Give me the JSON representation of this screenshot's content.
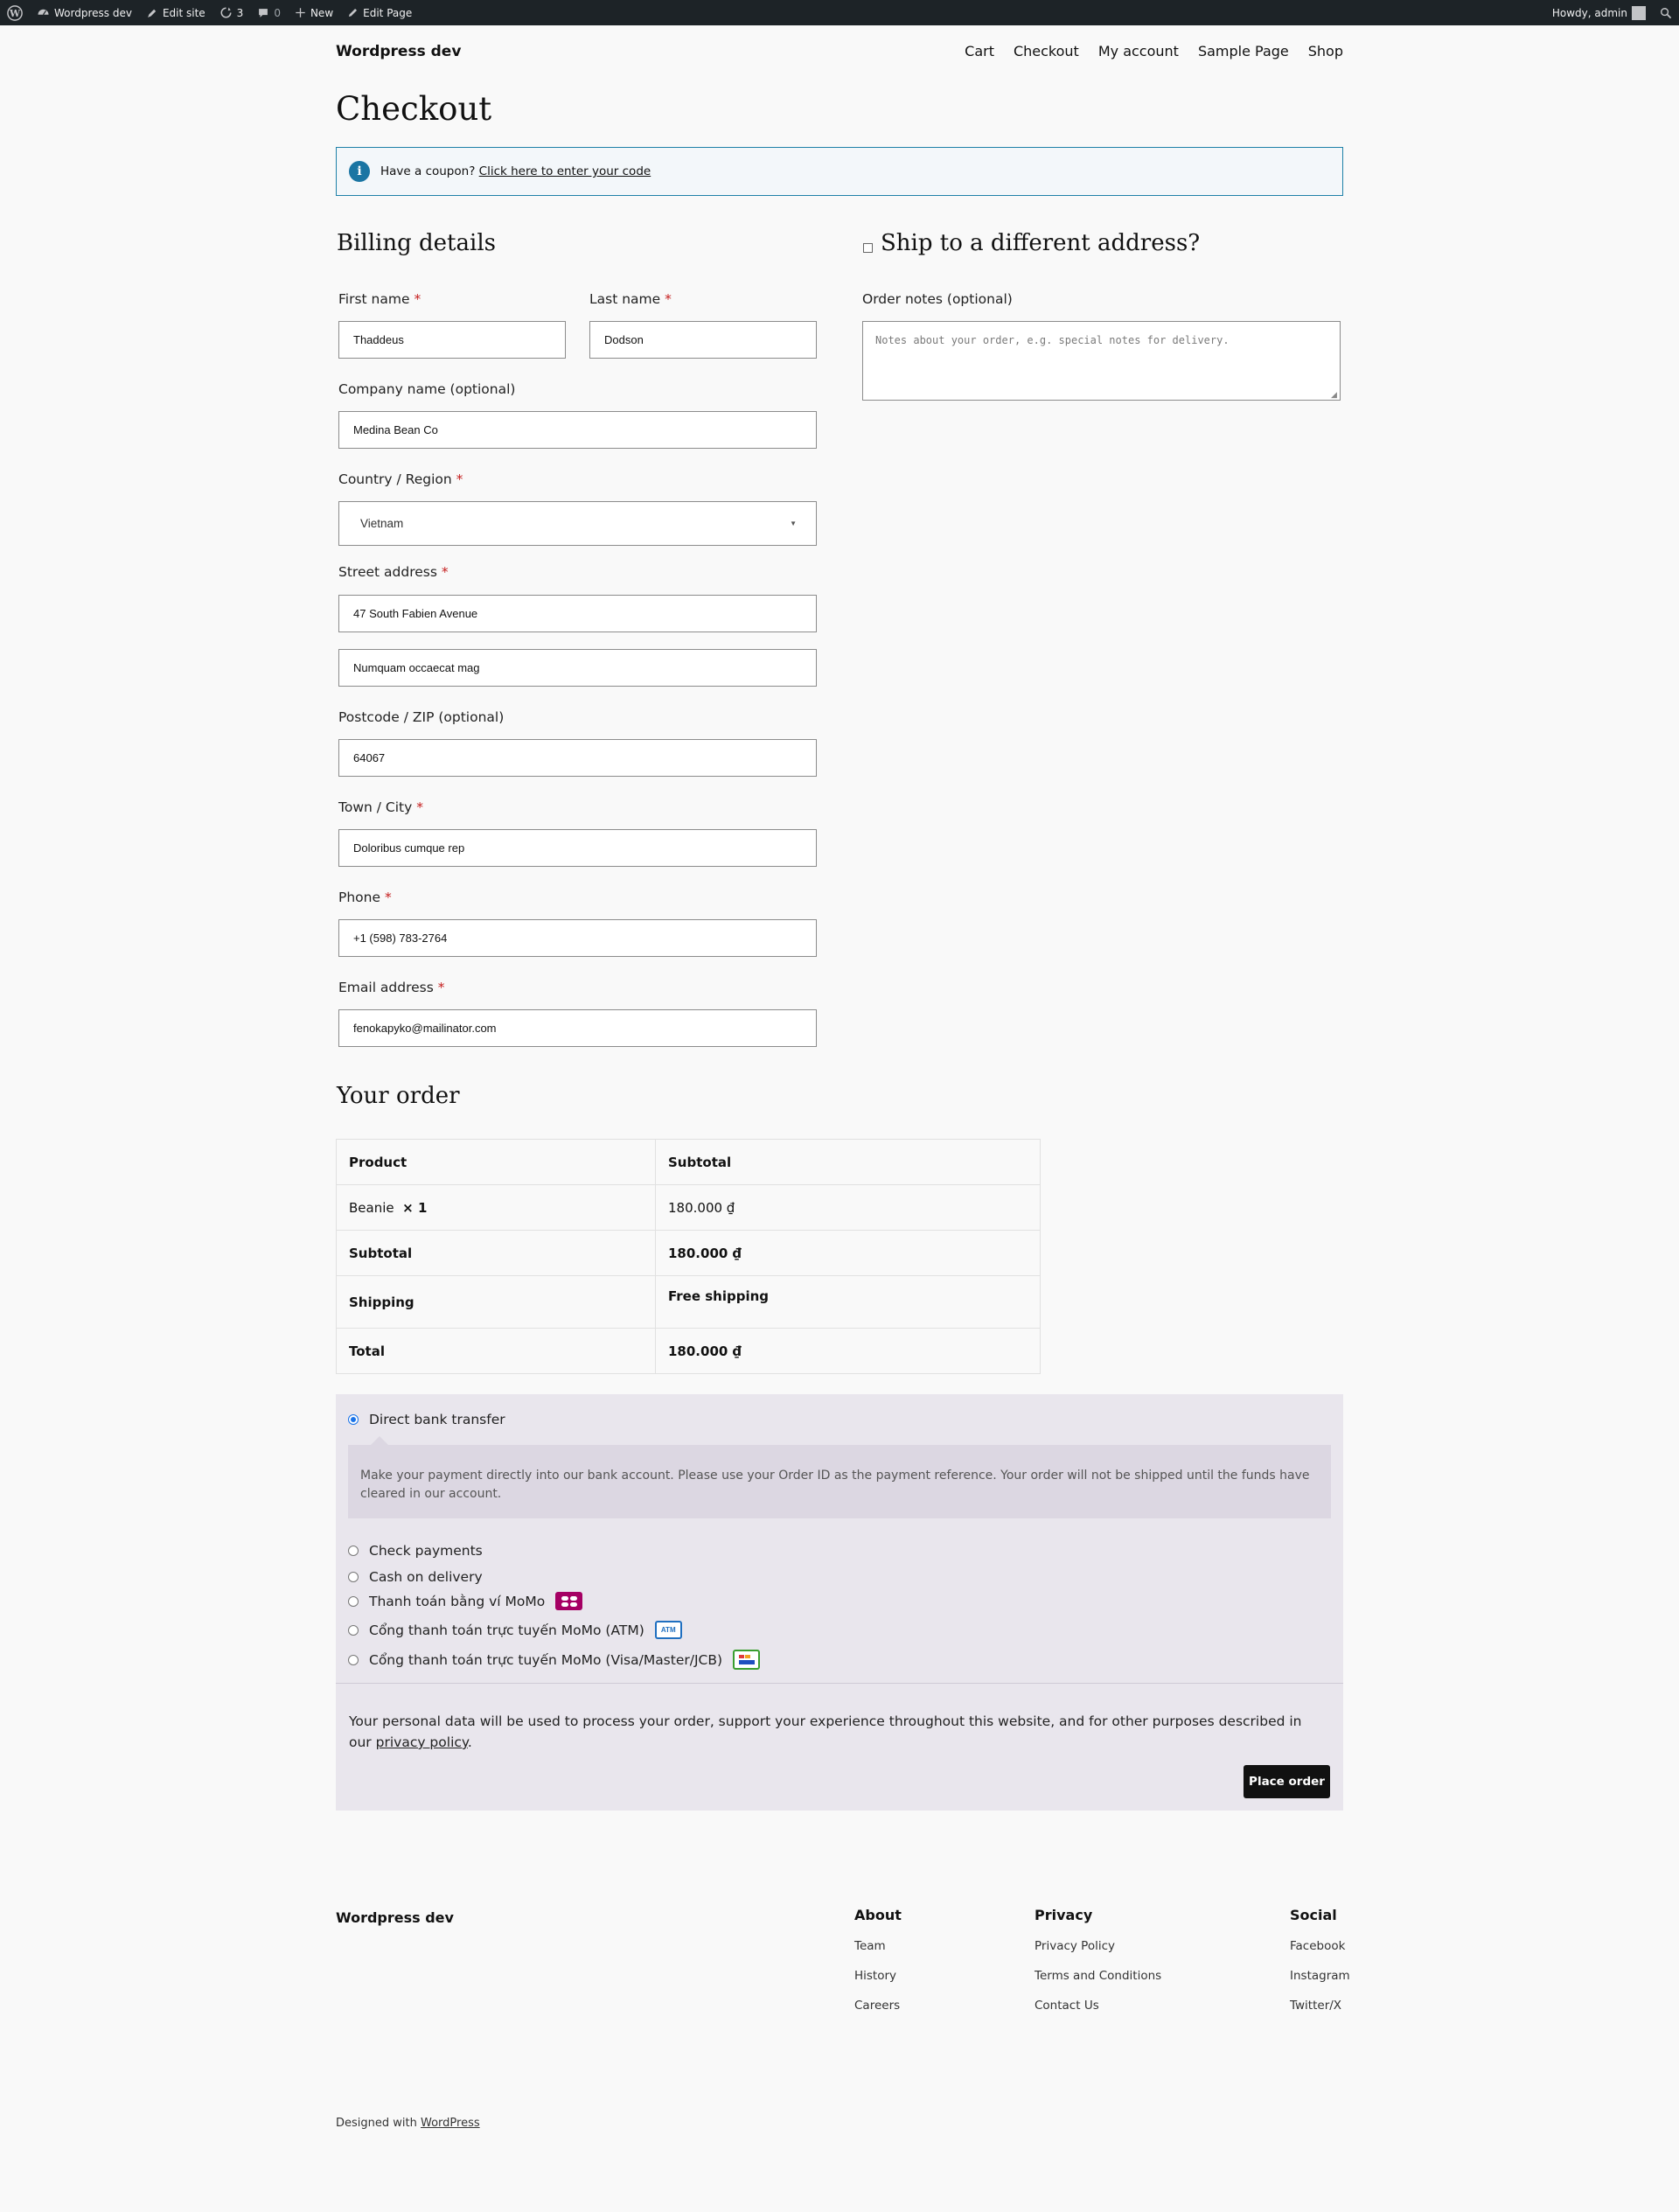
{
  "admin_bar": {
    "site_name": "Wordpress dev",
    "edit_site": "Edit site",
    "updates_count": "3",
    "comments_count": "0",
    "new_label": "New",
    "edit_page": "Edit Page",
    "howdy": "Howdy, admin"
  },
  "header": {
    "site_title": "Wordpress dev",
    "nav": [
      "Cart",
      "Checkout",
      "My account",
      "Sample Page",
      "Shop"
    ]
  },
  "page_title": "Checkout",
  "coupon": {
    "text": "Have a coupon?",
    "link": "Click here to enter your code"
  },
  "billing": {
    "heading": "Billing details",
    "first_name": {
      "label": "First name",
      "value": "Thaddeus"
    },
    "last_name": {
      "label": "Last name",
      "value": "Dodson"
    },
    "company": {
      "label": "Company name (optional)",
      "value": "Medina Bean Co"
    },
    "country": {
      "label": "Country / Region",
      "value": "Vietnam"
    },
    "street": {
      "label": "Street address",
      "value1": "47 South Fabien Avenue",
      "value2": "Numquam occaecat mag"
    },
    "postcode": {
      "label": "Postcode / ZIP (optional)",
      "value": "64067"
    },
    "city": {
      "label": "Town / City",
      "value": "Doloribus cumque rep"
    },
    "phone": {
      "label": "Phone",
      "value": "+1 (598) 783-2764"
    },
    "email": {
      "label": "Email address",
      "value": "fenokapyko@mailinator.com"
    },
    "required_mark": "*"
  },
  "shipping": {
    "heading": "Ship to a different address?",
    "notes_label": "Order notes (optional)",
    "notes_placeholder": "Notes about your order, e.g. special notes for delivery."
  },
  "order": {
    "heading": "Your order",
    "col_product": "Product",
    "col_subtotal": "Subtotal",
    "item_name": "Beanie",
    "item_qty": "× 1",
    "item_price": "180.000 ₫",
    "subtotal_label": "Subtotal",
    "subtotal_value": "180.000 ₫",
    "shipping_label": "Shipping",
    "shipping_value": "Free shipping",
    "total_label": "Total",
    "total_value": "180.000 ₫"
  },
  "payment": {
    "methods": [
      "Direct bank transfer",
      "Check payments",
      "Cash on delivery",
      "Thanh toán bằng ví MoMo",
      "Cổng thanh toán trực tuyến MoMo (ATM)",
      "Cổng thanh toán trực tuyến MoMo (Visa/Master/JCB)"
    ],
    "selected": "Direct bank transfer",
    "description": "Make your payment directly into our bank account. Please use your Order ID as the payment reference. Your order will not be shipped until the funds have cleared in our account.",
    "atm_badge": "ATM",
    "privacy_text": "Your personal data will be used to process your order, support your experience throughout this website, and for other purposes described in our",
    "privacy_link": "privacy policy",
    "privacy_end": ".",
    "place_order": "Place order"
  },
  "footer": {
    "site_title": "Wordpress dev",
    "about": {
      "title": "About",
      "links": [
        "Team",
        "History",
        "Careers"
      ]
    },
    "privacy": {
      "title": "Privacy",
      "links": [
        "Privacy Policy",
        "Terms and Conditions",
        "Contact Us"
      ]
    },
    "social": {
      "title": "Social",
      "links": [
        "Facebook",
        "Instagram",
        "Twitter/X"
      ]
    },
    "designed_with": "Designed with",
    "designed_link": "WordPress"
  },
  "colors": {
    "admin_bar": "#1d2327",
    "coupon_border": "#1f81a8",
    "required": "#c51e1e",
    "payment_bg": "#e9e6ed",
    "momo": "#a50064",
    "button": "#111111"
  }
}
